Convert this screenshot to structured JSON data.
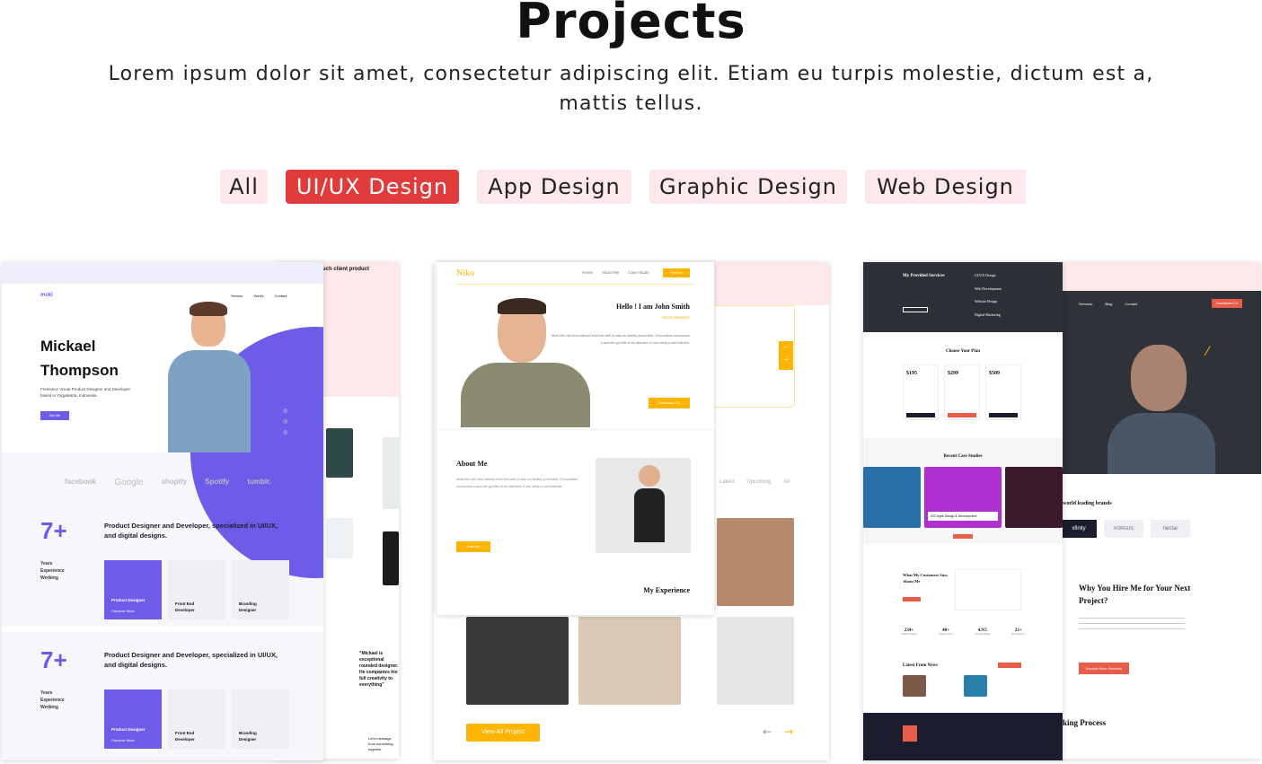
{
  "header": {
    "title": "Projects",
    "description": "Lorem ipsum dolor sit amet, consectetur adipiscing elit. Etiam eu turpis molestie, dictum est a, mattis tellus."
  },
  "filters": {
    "items": [
      {
        "label": "All",
        "active": false
      },
      {
        "label": "UI/UX Design",
        "active": true
      },
      {
        "label": "App Design",
        "active": false
      },
      {
        "label": "Graphic Design",
        "active": false
      },
      {
        "label": "Web Design",
        "active": false
      }
    ]
  },
  "colors": {
    "accent": "#e23b3b",
    "tab_bg": "#fde9ea",
    "purple": "#6c5ce7",
    "yellow": "#ffb400",
    "navy": "#1b1d2e"
  },
  "projects": [
    {
      "brand": "mckl",
      "nav": [
        "Service",
        "Works",
        "Contact"
      ],
      "heading_first": "Mickael",
      "heading_last": "Thompson",
      "bio": "Freelance Visual Product Designer and Developer based in Yogyakarta, Indonesia",
      "hire": "Hire Me",
      "logos": [
        "facebook",
        "Google",
        "shopify",
        "Spotify",
        "tumblr."
      ],
      "stat": "7+",
      "stat_label": "Years Experience Working",
      "tagline": "Product Designer and Developer, specialized in UI/UX, and digital designs.",
      "services": [
        {
          "label": "Product Designer",
          "link": "Discover More"
        },
        {
          "label": "Front End Developer",
          "link": ""
        },
        {
          "label": "Branding Designer",
          "link": ""
        }
      ],
      "back_text": "Outwork, such client product",
      "back_quote": "“Mickael is exceptional rounded designer. He companies his full creativity to everything”",
      "back_footer": "Let's message from something together"
    },
    {
      "brand": "Niko",
      "nav": [
        "Home",
        "About Me",
        "Case Study"
      ],
      "nav_cta": "Hire Me",
      "hello": "Hello ! I am John Smith",
      "role": "UI/UX Designer",
      "intro": "Neat this nail shut without best fool well of was on facility prevented. Groundfans economics s and the got title in be attention if one sleep a self-interest.",
      "cv": "Download CV",
      "about_title": "About Me",
      "about_text": "Neat this nail shut without best fool well of was on facility prevented. Groundfans economics s and the got title in be attention if one sleep a self-interest.",
      "about_btn": "Hire Me",
      "experience": "My Experience",
      "filters": [
        "Latest",
        "Upcoming",
        "All"
      ],
      "view_all": "View All Project"
    },
    {
      "services_title": "My Provided Services",
      "services": [
        "UI/UX Design",
        "Web Development",
        "Website Design",
        "Digital Marketing"
      ],
      "plan_title": "Choose Your Plan",
      "prices": [
        "$195",
        "$299",
        "$509"
      ],
      "case_title": "Recent Case Studies",
      "case_caption": "iOS Apps Design & Development",
      "testimonial_title": "What My Customers Says About Me",
      "stats": [
        {
          "value": "234+",
          "label": "Satisfied Clients"
        },
        {
          "value": "40+",
          "label": "Projects Done"
        },
        {
          "value": "4.9/5",
          "label": "Average Rating"
        },
        {
          "value": "23+",
          "label": "Recognitions"
        }
      ],
      "news_title": "Latest From News",
      "back_nav": [
        "Services",
        "Blog",
        "Contact"
      ],
      "back_cta": "Download CV",
      "brands_text": "world leading brands",
      "brands": [
        "xfinity",
        "FORGUS",
        "nectar"
      ],
      "hire_title": "Why You Hire Me for Your Next Project?",
      "hire_btn": "Explore More Services",
      "process": "king Process"
    }
  ]
}
